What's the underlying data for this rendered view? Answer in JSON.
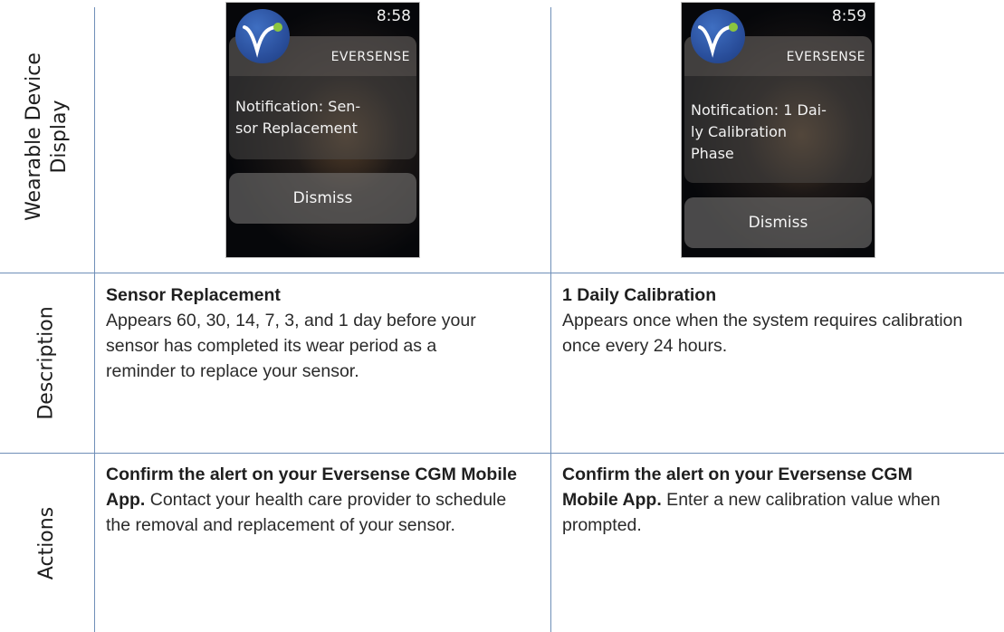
{
  "row_headers": {
    "display": [
      "Wearable Device",
      "Display"
    ],
    "description": "Description",
    "actions": "Actions"
  },
  "watches": [
    {
      "time": "8:58",
      "brand": "EVERSENSE",
      "notification": [
        "Notification: Sen-",
        "sor Replacement"
      ],
      "button": "Dismiss",
      "icon": "eversense-logo-icon"
    },
    {
      "time": "8:59",
      "brand": "EVERSENSE",
      "notification": [
        "Notification: 1 Dai-",
        "ly Calibration",
        "Phase"
      ],
      "button": "Dismiss",
      "icon": "eversense-logo-icon"
    }
  ],
  "descriptions": [
    {
      "title": "Sensor Replacement",
      "lines": [
        "Appears 60, 30, 14, 7, 3, and 1 day before your",
        "sensor has completed its wear period as a",
        "reminder to replace your sensor."
      ]
    },
    {
      "title": "1 Daily Calibration",
      "lines": [
        "Appears once when the system requires calibration",
        "once every 24 hours."
      ]
    }
  ],
  "actions": [
    {
      "bold_lines": [
        "Confirm the alert on your Eversense CGM Mobile",
        "App."
      ],
      "rest_first": " Contact your health care provider to schedule",
      "rest_lines": [
        "the removal and replacement of your sensor."
      ]
    },
    {
      "bold_lines": [
        "Confirm the alert on your Eversense CGM",
        "Mobile App."
      ],
      "rest_first": " Enter a new calibration value when",
      "rest_lines": [
        "prompted."
      ]
    }
  ],
  "colors": {
    "grid_line": "#6f8fb8",
    "logo_blue": "#2a4f9c",
    "logo_green": "#8cc63f"
  }
}
